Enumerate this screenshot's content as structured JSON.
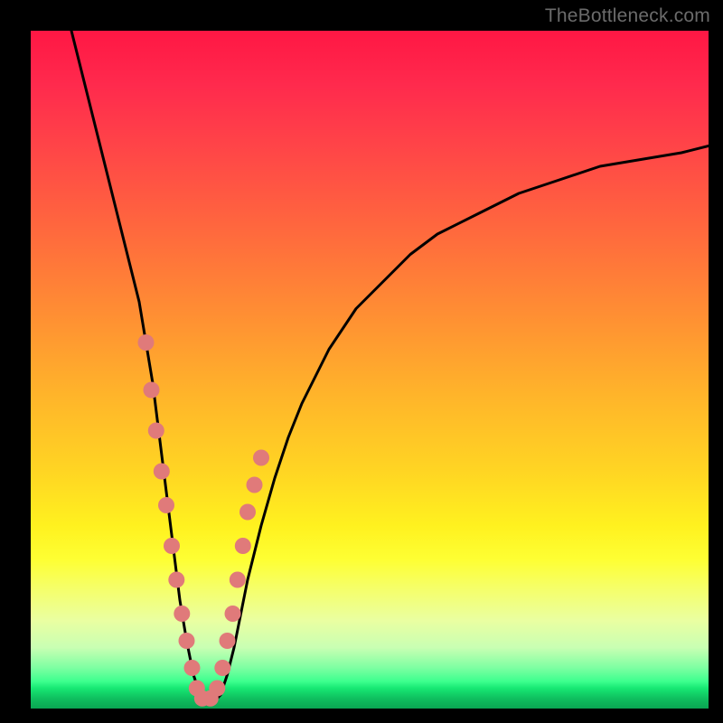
{
  "watermark": "TheBottleneck.com",
  "chart_data": {
    "type": "line",
    "title": "",
    "xlabel": "",
    "ylabel": "",
    "xlim": [
      0,
      100
    ],
    "ylim": [
      0,
      100
    ],
    "series": [
      {
        "name": "bottleneck-curve",
        "x": [
          6,
          8,
          10,
          12,
          14,
          16,
          17,
          18,
          19,
          20,
          21,
          22,
          23,
          24,
          25,
          26,
          27,
          28,
          29,
          30,
          31,
          32,
          34,
          36,
          38,
          40,
          44,
          48,
          52,
          56,
          60,
          66,
          72,
          78,
          84,
          90,
          96,
          100
        ],
        "y": [
          100,
          92,
          84,
          76,
          68,
          60,
          54,
          48,
          40,
          32,
          24,
          16,
          10,
          5,
          2,
          1,
          1,
          2,
          5,
          9,
          14,
          19,
          27,
          34,
          40,
          45,
          53,
          59,
          63,
          67,
          70,
          73,
          76,
          78,
          80,
          81,
          82,
          83
        ]
      }
    ],
    "markers": {
      "name": "highlight-dots",
      "color": "#e07a7a",
      "points_x": [
        17.0,
        17.8,
        18.5,
        19.3,
        20.0,
        20.8,
        21.5,
        22.3,
        23.0,
        23.8,
        24.5,
        25.3,
        26.5,
        27.5,
        28.3,
        29.0,
        29.8,
        30.5,
        31.3,
        32.0,
        33.0,
        34.0
      ],
      "points_y": [
        54,
        47,
        41,
        35,
        30,
        24,
        19,
        14,
        10,
        6,
        3,
        1.5,
        1.5,
        3,
        6,
        10,
        14,
        19,
        24,
        29,
        33,
        37
      ]
    },
    "gradient_stops": [
      {
        "pos": 0.0,
        "color": "#ff1744"
      },
      {
        "pos": 0.3,
        "color": "#ff6a3d"
      },
      {
        "pos": 0.65,
        "color": "#ffd523"
      },
      {
        "pos": 0.82,
        "color": "#f6ff66"
      },
      {
        "pos": 0.94,
        "color": "#7dffa2"
      },
      {
        "pos": 1.0,
        "color": "#0aa552"
      }
    ]
  }
}
